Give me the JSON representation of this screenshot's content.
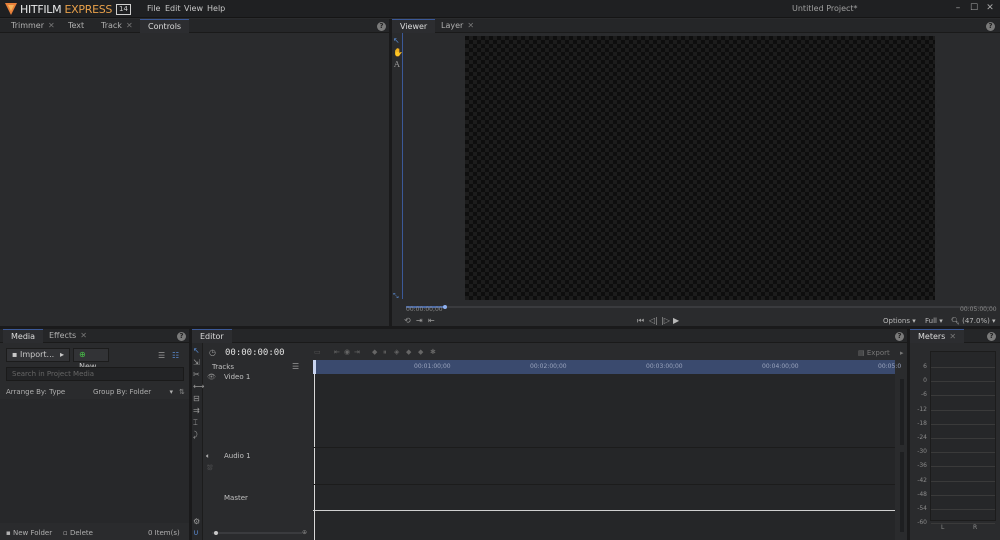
{
  "app": {
    "brand_main": "HITFILM",
    "brand_express": " EXPRESS",
    "brand_version": "14",
    "project_title": "Untitled Project*"
  },
  "menu": [
    "File",
    "Edit",
    "View",
    "Help"
  ],
  "top_left_panel": {
    "tabs": [
      {
        "label": "Trimmer",
        "closable": true
      },
      {
        "label": "Text",
        "closable": false
      },
      {
        "label": "Track",
        "closable": true
      },
      {
        "label": "Controls",
        "closable": false,
        "active": true
      }
    ]
  },
  "viewer_panel": {
    "tabs": [
      {
        "label": "Viewer",
        "active": true,
        "closable": false
      },
      {
        "label": "Layer",
        "closable": true
      }
    ],
    "time_start": "00:00:00;00",
    "time_end": "00:05:00;00",
    "options_label": "Options",
    "quality_label": "Full",
    "zoom_label": "(47.0%)"
  },
  "media_panel": {
    "tabs": [
      {
        "label": "Media",
        "active": true
      },
      {
        "label": "Effects",
        "closable": true
      }
    ],
    "import_label": "Import...",
    "new_label": "New",
    "search_placeholder": "Search in Project Media",
    "arrange_label": "Arrange By: Type",
    "group_label": "Group By: Folder",
    "new_folder_label": "New Folder",
    "delete_label": "Delete",
    "item_count": "0 Item(s)"
  },
  "editor_panel": {
    "tab_label": "Editor",
    "timecode": "00:00:00:00",
    "export_label": "Export",
    "tracks_label": "Tracks",
    "video_track": "Video 1",
    "audio_track": "Audio 1",
    "master_track": "Master",
    "ruler_marks": [
      "00:01:00;00",
      "00:02:00;00",
      "00:03:00;00",
      "00:04:00;00",
      "00:05:0"
    ]
  },
  "meters_panel": {
    "tab_label": "Meters",
    "scale": [
      "6",
      "0",
      "-6",
      "-12",
      "-18",
      "-24",
      "-30",
      "-36",
      "-42",
      "-48",
      "-54",
      "-60"
    ],
    "channels": [
      "L",
      "R"
    ]
  }
}
